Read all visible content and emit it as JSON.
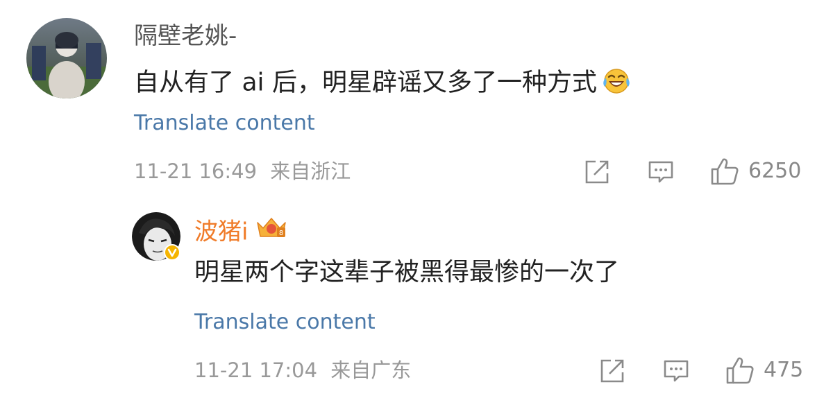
{
  "colors": {
    "username_main": "#555555",
    "username_reply": "#f07c2a",
    "link": "#4a78a8",
    "meta": "#999999",
    "text": "#222222"
  },
  "comments": [
    {
      "username": "隔壁老姚-",
      "text": "自从有了 ai 后，明星辟谣又多了一种方式",
      "emoji": "laugh-crying-icon",
      "translate_label": "Translate content",
      "timestamp": "11-21 16:49",
      "location": "来自浙江",
      "likes": "6250"
    },
    {
      "username": "波猪i",
      "badge": "crown-badge-icon",
      "verified": true,
      "text": "明星两个字这辈子被黑得最惨的一次了",
      "translate_label": "Translate content",
      "timestamp": "11-21 17:04",
      "location": "来自广东",
      "likes": "475"
    }
  ]
}
